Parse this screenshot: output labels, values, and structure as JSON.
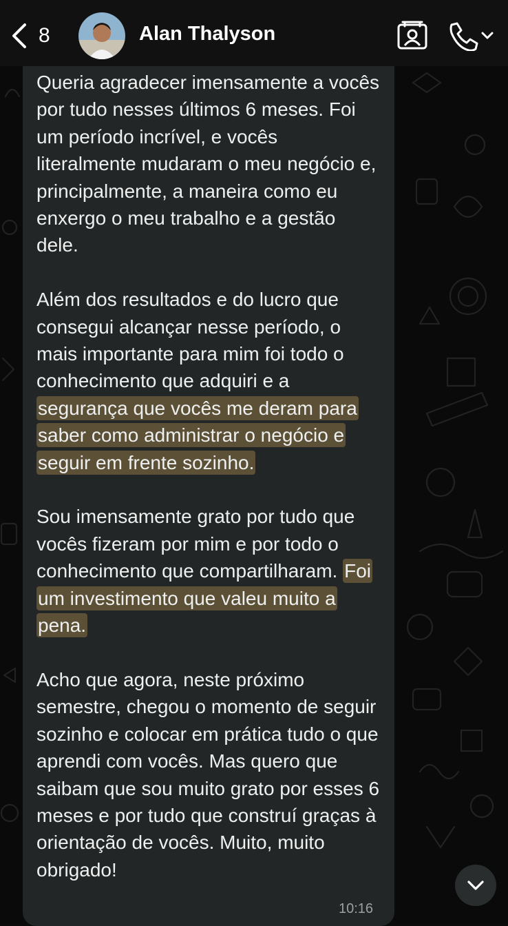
{
  "header": {
    "back_count": "8",
    "contact_name": "Alan Thalyson"
  },
  "message": {
    "paragraphs": [
      {
        "segments": [
          {
            "text": "Queria agradecer imensamente a vocês por tudo nesses últimos 6 meses. Foi um período incrível, e vocês literalmente mudaram o meu negócio e, principalmente, a maneira como eu enxergo o meu trabalho e a gestão dele.",
            "highlight": false
          }
        ]
      },
      {
        "segments": [
          {
            "text": "Além dos resultados e do lucro que consegui alcançar nesse período, o mais importante para mim foi todo o conhecimento que adquiri e a ",
            "highlight": false
          },
          {
            "text": "segurança que vocês me deram para saber como administrar o negócio e seguir em frente sozinho.",
            "highlight": true
          }
        ]
      },
      {
        "segments": [
          {
            "text": "Sou imensamente grato por tudo que vocês fizeram por mim e por todo o conhecimento que compartilharam. ",
            "highlight": false
          },
          {
            "text": "Foi um investimento que valeu muito a pena.",
            "highlight": true
          }
        ]
      },
      {
        "segments": [
          {
            "text": "Acho que agora, neste próximo semestre, chegou o momento de seguir sozinho e colocar em prática tudo o que aprendi com vocês. Mas quero que saibam que sou muito grato por esses 6 meses e por tudo que construí graças à orientação de vocês. Muito, muito obrigado!",
            "highlight": false
          }
        ]
      }
    ],
    "timestamp": "10:16"
  },
  "colors": {
    "bubble": "#232626",
    "highlight": "#5c5036",
    "header": "#111111",
    "text": "#eef0f0"
  },
  "icons": [
    "chevron-left-icon",
    "contact-card-icon",
    "phone-icon",
    "chevron-down-icon"
  ]
}
